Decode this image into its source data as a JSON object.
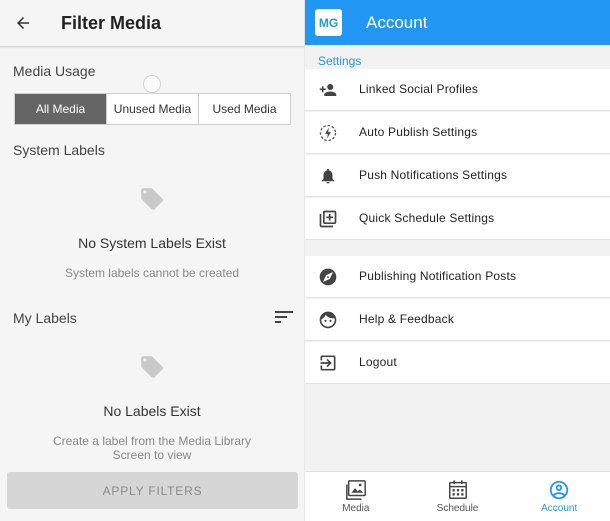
{
  "filter_panel": {
    "title": "Filter Media",
    "back_icon": "arrow-left-icon",
    "media_usage": {
      "label": "Media Usage",
      "options": [
        "All Media",
        "Unused Media",
        "Used Media"
      ],
      "selected": "All Media"
    },
    "system_labels": {
      "label": "System Labels",
      "icon": "tag-icon",
      "empty_title": "No System Labels Exist",
      "empty_subtitle": "System labels cannot be created"
    },
    "my_labels": {
      "label": "My Labels",
      "sort_icon": "sort-icon",
      "icon": "tag-icon",
      "empty_title": "No Labels Exist",
      "empty_subtitle": "Create a label from the Media Library Screen to view"
    },
    "apply_button": "APPLY FILTERS"
  },
  "account_panel": {
    "avatar_initials": "MG",
    "title": "Account",
    "settings_header": "Settings",
    "settings_items": [
      {
        "label": "Linked Social Profiles",
        "icon": "add-person-icon"
      },
      {
        "label": "Auto Publish Settings",
        "icon": "auto-publish-icon"
      },
      {
        "label": "Push Notifications Settings",
        "icon": "bell-icon"
      },
      {
        "label": "Quick Schedule Settings",
        "icon": "add-box-icon"
      }
    ],
    "other_items": [
      {
        "label": "Publishing Notification Posts",
        "icon": "compass-icon"
      },
      {
        "label": "Help & Feedback",
        "icon": "face-icon"
      },
      {
        "label": "Logout",
        "icon": "logout-icon"
      }
    ],
    "bottom_nav": [
      {
        "label": "Media",
        "icon": "image-icon"
      },
      {
        "label": "Schedule",
        "icon": "calendar-icon"
      },
      {
        "label": "Account",
        "icon": "account-circle-icon",
        "active": true
      }
    ]
  },
  "colors": {
    "primary": "#2196f3",
    "segment_active": "#656565",
    "apply_disabled": "#d6d6d6"
  }
}
